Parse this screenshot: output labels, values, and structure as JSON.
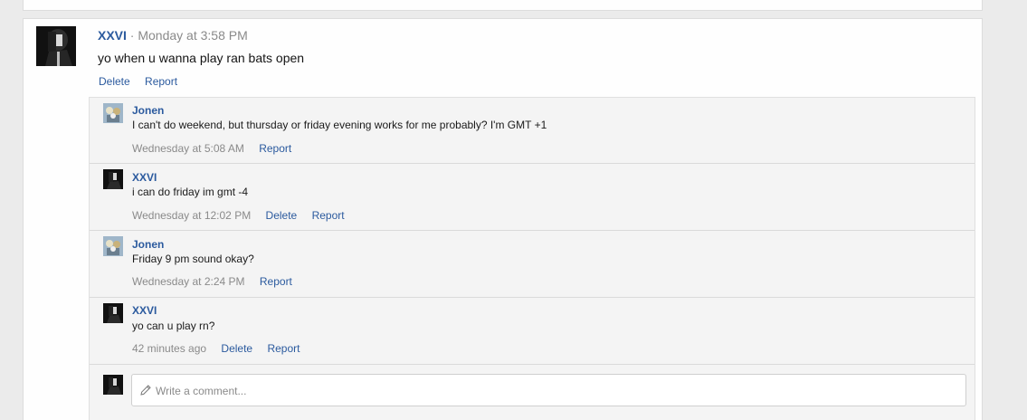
{
  "status": {
    "author": "XXVI",
    "time": "Monday at 3:58 PM",
    "separator": "·",
    "text": "yo when u wanna play ran bats open",
    "actions": {
      "delete": "Delete",
      "report": "Report"
    }
  },
  "comments": [
    {
      "author": "Jonen",
      "avatar": "jonen-avatar",
      "text": "I can't do weekend, but thursday or friday evening works for me probably? I'm GMT +1",
      "time": "Wednesday at 5:08 AM",
      "delete": "",
      "report": "Report"
    },
    {
      "author": "XXVI",
      "avatar": "xxvi-avatar",
      "text": "i can do friday im gmt -4",
      "time": "Wednesday at 12:02 PM",
      "delete": "Delete",
      "report": "Report"
    },
    {
      "author": "Jonen",
      "avatar": "jonen-avatar",
      "text": "Friday 9 pm sound okay?",
      "time": "Wednesday at 2:24 PM",
      "delete": "",
      "report": "Report"
    },
    {
      "author": "XXVI",
      "avatar": "xxvi-avatar",
      "text": "yo can u play rn?",
      "time": "42 minutes ago",
      "delete": "Delete",
      "report": "Report"
    }
  ],
  "composer": {
    "placeholder": "Write a comment...",
    "icon": "pencil-icon"
  },
  "colors": {
    "link": "#2b5a9e",
    "muted": "#8a8a8a",
    "page_bg": "#ebebeb",
    "comments_bg": "#f4f4f4"
  }
}
